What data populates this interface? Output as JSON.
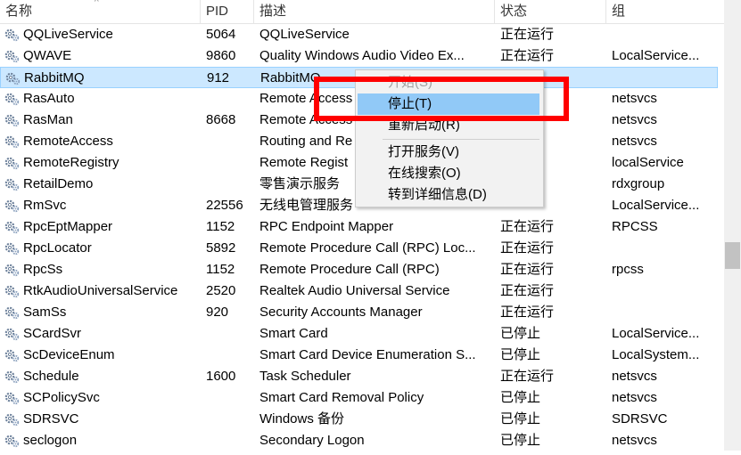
{
  "columns": {
    "name": "名称",
    "pid": "PID",
    "desc": "描述",
    "status": "状态",
    "group": "组"
  },
  "rows": [
    {
      "name": "QQLiveService",
      "pid": "5064",
      "desc": "QQLiveService",
      "status": "正在运行",
      "group": ""
    },
    {
      "name": "QWAVE",
      "pid": "9860",
      "desc": "Quality Windows Audio Video Ex...",
      "status": "正在运行",
      "group": "LocalService..."
    },
    {
      "name": "RabbitMQ",
      "pid": "912",
      "desc": "RabbitMQ",
      "status": "",
      "group": ""
    },
    {
      "name": "RasAuto",
      "pid": "",
      "desc": "Remote Access",
      "status": "",
      "group": "netsvcs"
    },
    {
      "name": "RasMan",
      "pid": "8668",
      "desc": "Remote Access",
      "status": "",
      "group": "netsvcs"
    },
    {
      "name": "RemoteAccess",
      "pid": "",
      "desc": "Routing and Re",
      "status": "",
      "group": "netsvcs"
    },
    {
      "name": "RemoteRegistry",
      "pid": "",
      "desc": "Remote Regist",
      "status": "",
      "group": "localService"
    },
    {
      "name": "RetailDemo",
      "pid": "",
      "desc": "零售演示服务",
      "status": "",
      "group": "rdxgroup"
    },
    {
      "name": "RmSvc",
      "pid": "22556",
      "desc": "无线电管理服务",
      "status": "",
      "group": "LocalService..."
    },
    {
      "name": "RpcEptMapper",
      "pid": "1152",
      "desc": "RPC Endpoint Mapper",
      "status": "正在运行",
      "group": "RPCSS"
    },
    {
      "name": "RpcLocator",
      "pid": "5892",
      "desc": "Remote Procedure Call (RPC) Loc...",
      "status": "正在运行",
      "group": ""
    },
    {
      "name": "RpcSs",
      "pid": "1152",
      "desc": "Remote Procedure Call (RPC)",
      "status": "正在运行",
      "group": "rpcss"
    },
    {
      "name": "RtkAudioUniversalService",
      "pid": "2520",
      "desc": "Realtek Audio Universal Service",
      "status": "正在运行",
      "group": ""
    },
    {
      "name": "SamSs",
      "pid": "920",
      "desc": "Security Accounts Manager",
      "status": "正在运行",
      "group": ""
    },
    {
      "name": "SCardSvr",
      "pid": "",
      "desc": "Smart Card",
      "status": "已停止",
      "group": "LocalService..."
    },
    {
      "name": "ScDeviceEnum",
      "pid": "",
      "desc": "Smart Card Device Enumeration S...",
      "status": "已停止",
      "group": "LocalSystem..."
    },
    {
      "name": "Schedule",
      "pid": "1600",
      "desc": "Task Scheduler",
      "status": "正在运行",
      "group": "netsvcs"
    },
    {
      "name": "SCPolicySvc",
      "pid": "",
      "desc": "Smart Card Removal Policy",
      "status": "已停止",
      "group": "netsvcs"
    },
    {
      "name": "SDRSVC",
      "pid": "",
      "desc": "Windows 备份",
      "status": "已停止",
      "group": "SDRSVC"
    },
    {
      "name": "seclogon",
      "pid": "",
      "desc": "Secondary Logon",
      "status": "已停止",
      "group": "netsvcs"
    }
  ],
  "context_menu": {
    "start": "开始(S)",
    "stop": "停止(T)",
    "restart": "重新启动(R)",
    "open_services": "打开服务(V)",
    "search_online": "在线搜索(O)",
    "go_to_details": "转到详细信息(D)"
  },
  "colors": {
    "selection": "#cce8ff",
    "menu_hover": "#91c9f7",
    "highlight": "#ff0000"
  }
}
